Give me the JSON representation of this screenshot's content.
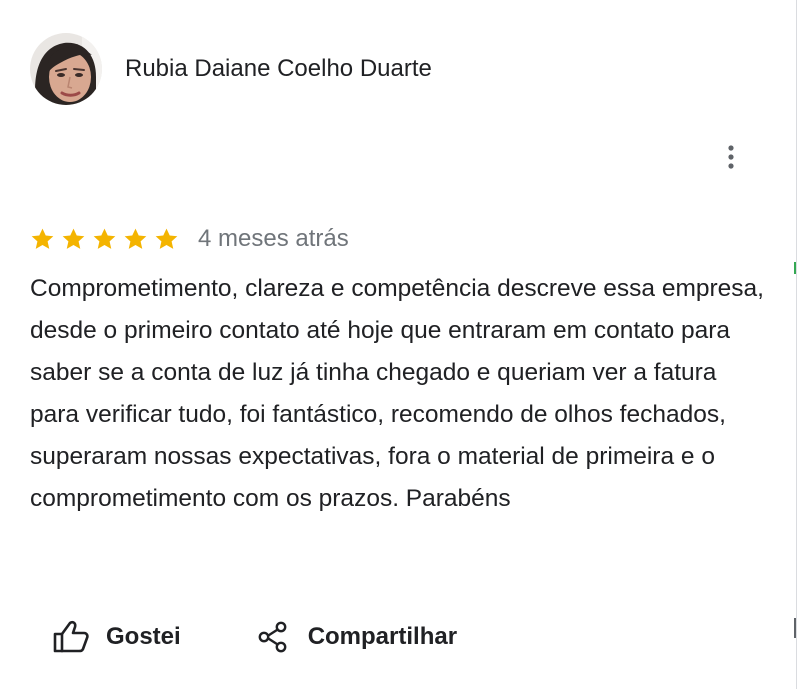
{
  "review": {
    "reviewer_name": "Rubia Daiane Coelho Duarte",
    "rating": 5,
    "rating_max": 5,
    "date": "4 meses atrás",
    "text": "Comprometimento, clareza e competência descreve essa empresa, desde o primeiro contato até hoje que entraram em contato para saber se a conta de luz já tinha chegado e queriam ver a fatura para verificar tudo, foi fantástico, recomendo de olhos fechados, superaram nossas expectativas, fora o material de primeira e o comprometimento com os prazos. Parabéns"
  },
  "actions": {
    "like_label": "Gostei",
    "share_label": "Compartilhar"
  },
  "icons": {
    "more": "more-vert-icon",
    "like": "thumb-up-icon",
    "share": "share-icon",
    "star": "star-icon"
  },
  "colors": {
    "star": "#f4b400",
    "text": "#202124",
    "secondary_text": "#70757a",
    "icon": "#5f6368"
  }
}
